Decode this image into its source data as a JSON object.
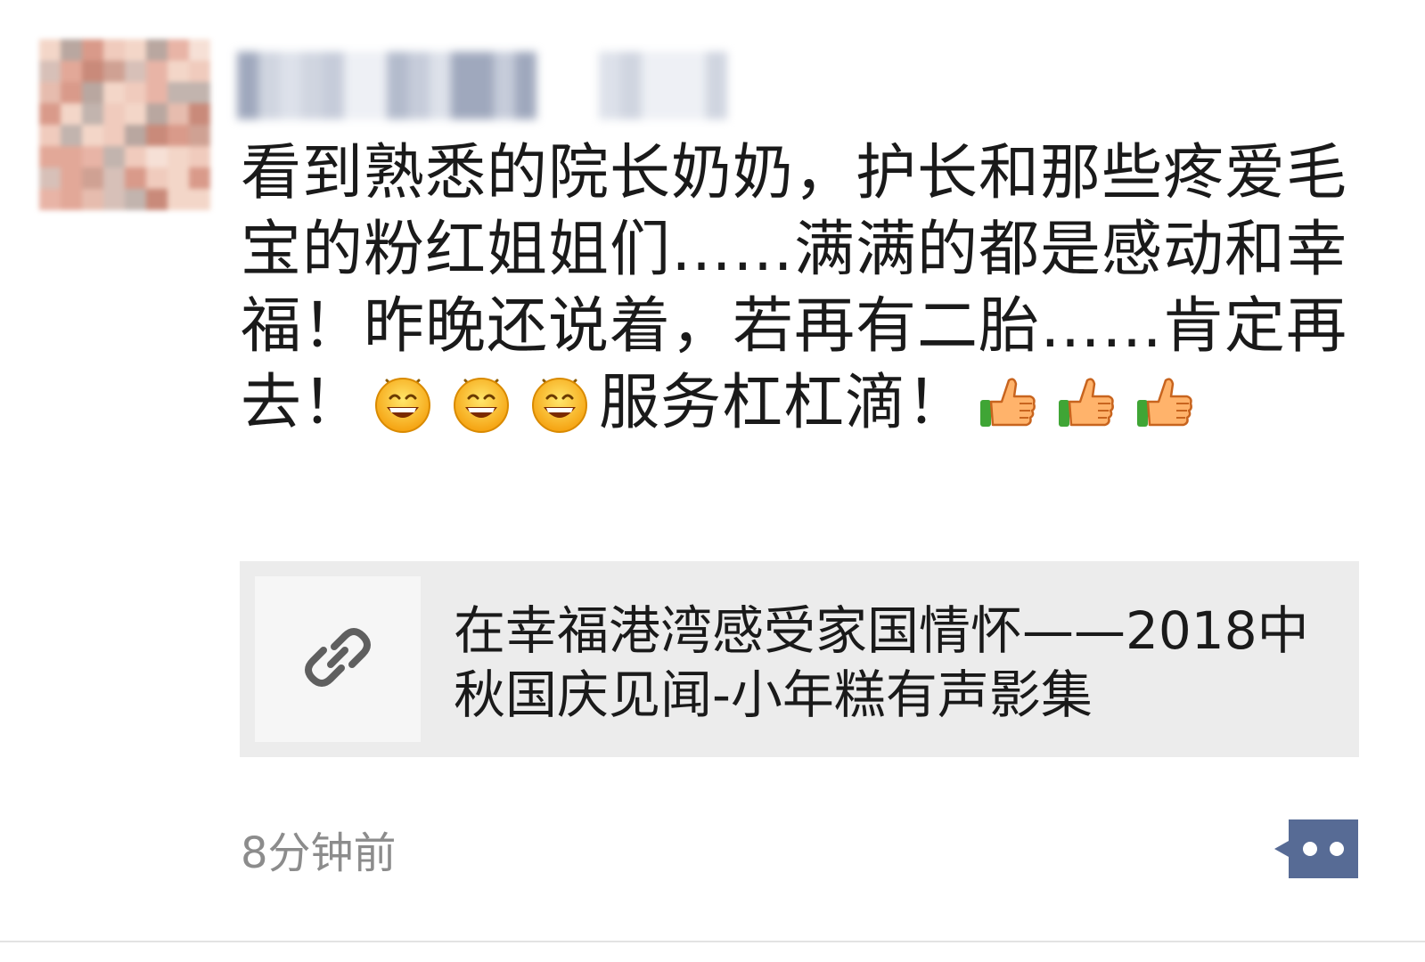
{
  "post": {
    "text_parts": [
      "看到熟悉的院长奶奶，护长和那些疼爱毛宝的粉红姐姐们……满满的都是感动和幸福！昨晚还说着，若再有二胎……肯定再去！",
      "服务杠杠滴！"
    ],
    "emojis": [
      "grin-emoji",
      "grin-emoji",
      "grin-emoji",
      "thumbs-up-emoji",
      "thumbs-up-emoji",
      "thumbs-up-emoji"
    ]
  },
  "link_card": {
    "title": "在幸福港湾感受家国情怀——2018中秋国庆见闻-小年糕有声影集",
    "icon": "link-icon"
  },
  "footer": {
    "timestamp": "8分钟前",
    "comment_icon": "comment-dots-icon"
  },
  "colors": {
    "link_card_bg": "#ececec",
    "comment_button": "#576b95",
    "timestamp": "#8c8c8c"
  }
}
